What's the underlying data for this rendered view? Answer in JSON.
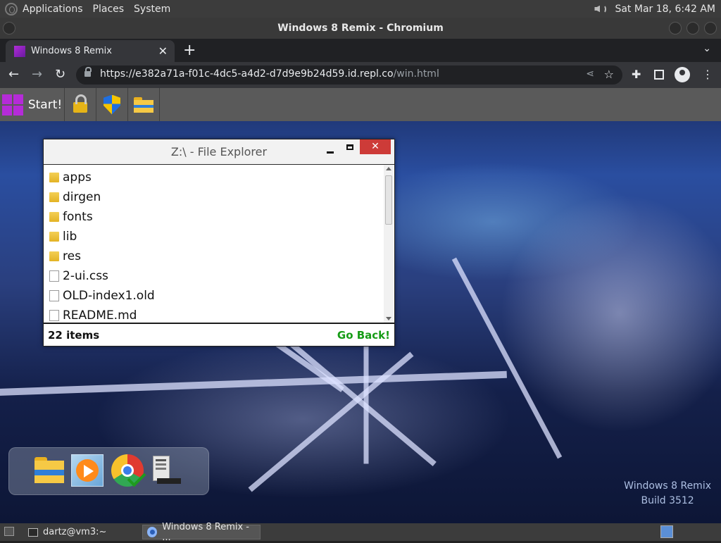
{
  "top_panel": {
    "menus": [
      "Applications",
      "Places",
      "System"
    ],
    "clock": "Sat Mar 18,  6:42 AM"
  },
  "window": {
    "title": "Windows 8 Remix - Chromium"
  },
  "browser": {
    "tab_title": "Windows 8 Remix",
    "tab_close": "✕",
    "new_tab": "+",
    "url_main": "https://e382a71a-f01c-4dc5-a4d2-d7d9e9b24d59.id.repl.co",
    "url_path": "/win.html"
  },
  "app_bar": {
    "start_label": "Start!"
  },
  "explorer": {
    "title": "Z:\\ - File Explorer",
    "close": "✕",
    "items": [
      {
        "name": "apps",
        "type": "folder"
      },
      {
        "name": "dirgen",
        "type": "folder"
      },
      {
        "name": "fonts",
        "type": "folder"
      },
      {
        "name": "lib",
        "type": "folder"
      },
      {
        "name": "res",
        "type": "folder"
      },
      {
        "name": "2-ui.css",
        "type": "file"
      },
      {
        "name": "OLD-index1.old",
        "type": "file"
      },
      {
        "name": "README.md",
        "type": "file"
      }
    ],
    "count": "22 items",
    "go_back": "Go Back!"
  },
  "watermark": {
    "line1": "Windows 8 Remix",
    "line2": "Build 3512"
  },
  "taskbar": {
    "items": [
      "dartz@vm3:~",
      "Windows 8 Remix - ..."
    ]
  }
}
